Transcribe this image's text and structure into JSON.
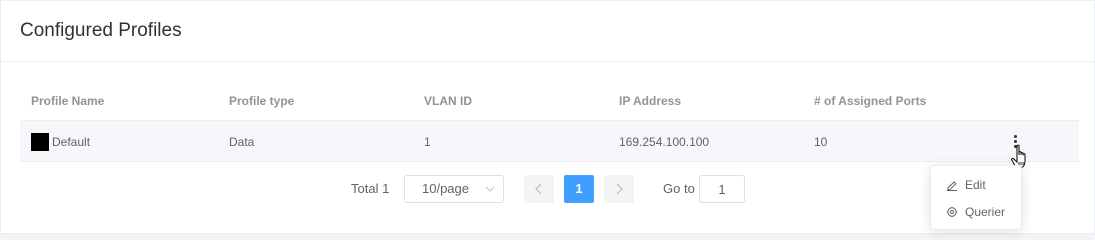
{
  "header": {
    "title": "Configured Profiles"
  },
  "table": {
    "columns": [
      "Profile Name",
      "Profile type",
      "VLAN ID",
      "IP Address",
      "# of Assigned Ports"
    ],
    "rows": [
      {
        "name": "Default",
        "type": "Data",
        "vlan_id": "1",
        "ip": "169.254.100.100",
        "ports": "10"
      }
    ]
  },
  "pagination": {
    "total_label": "Total 1",
    "page_size": "10/page",
    "current_page": "1",
    "goto_label": "Go to",
    "goto_value": "1"
  },
  "row_menu": {
    "items": [
      {
        "label": "Edit",
        "icon": "edit-icon"
      },
      {
        "label": "Querier",
        "icon": "querier-icon"
      }
    ]
  },
  "colors": {
    "accent": "#409eff",
    "header_text": "#909399",
    "body_text": "#606266",
    "row_highlight": "#f5f7fa"
  }
}
